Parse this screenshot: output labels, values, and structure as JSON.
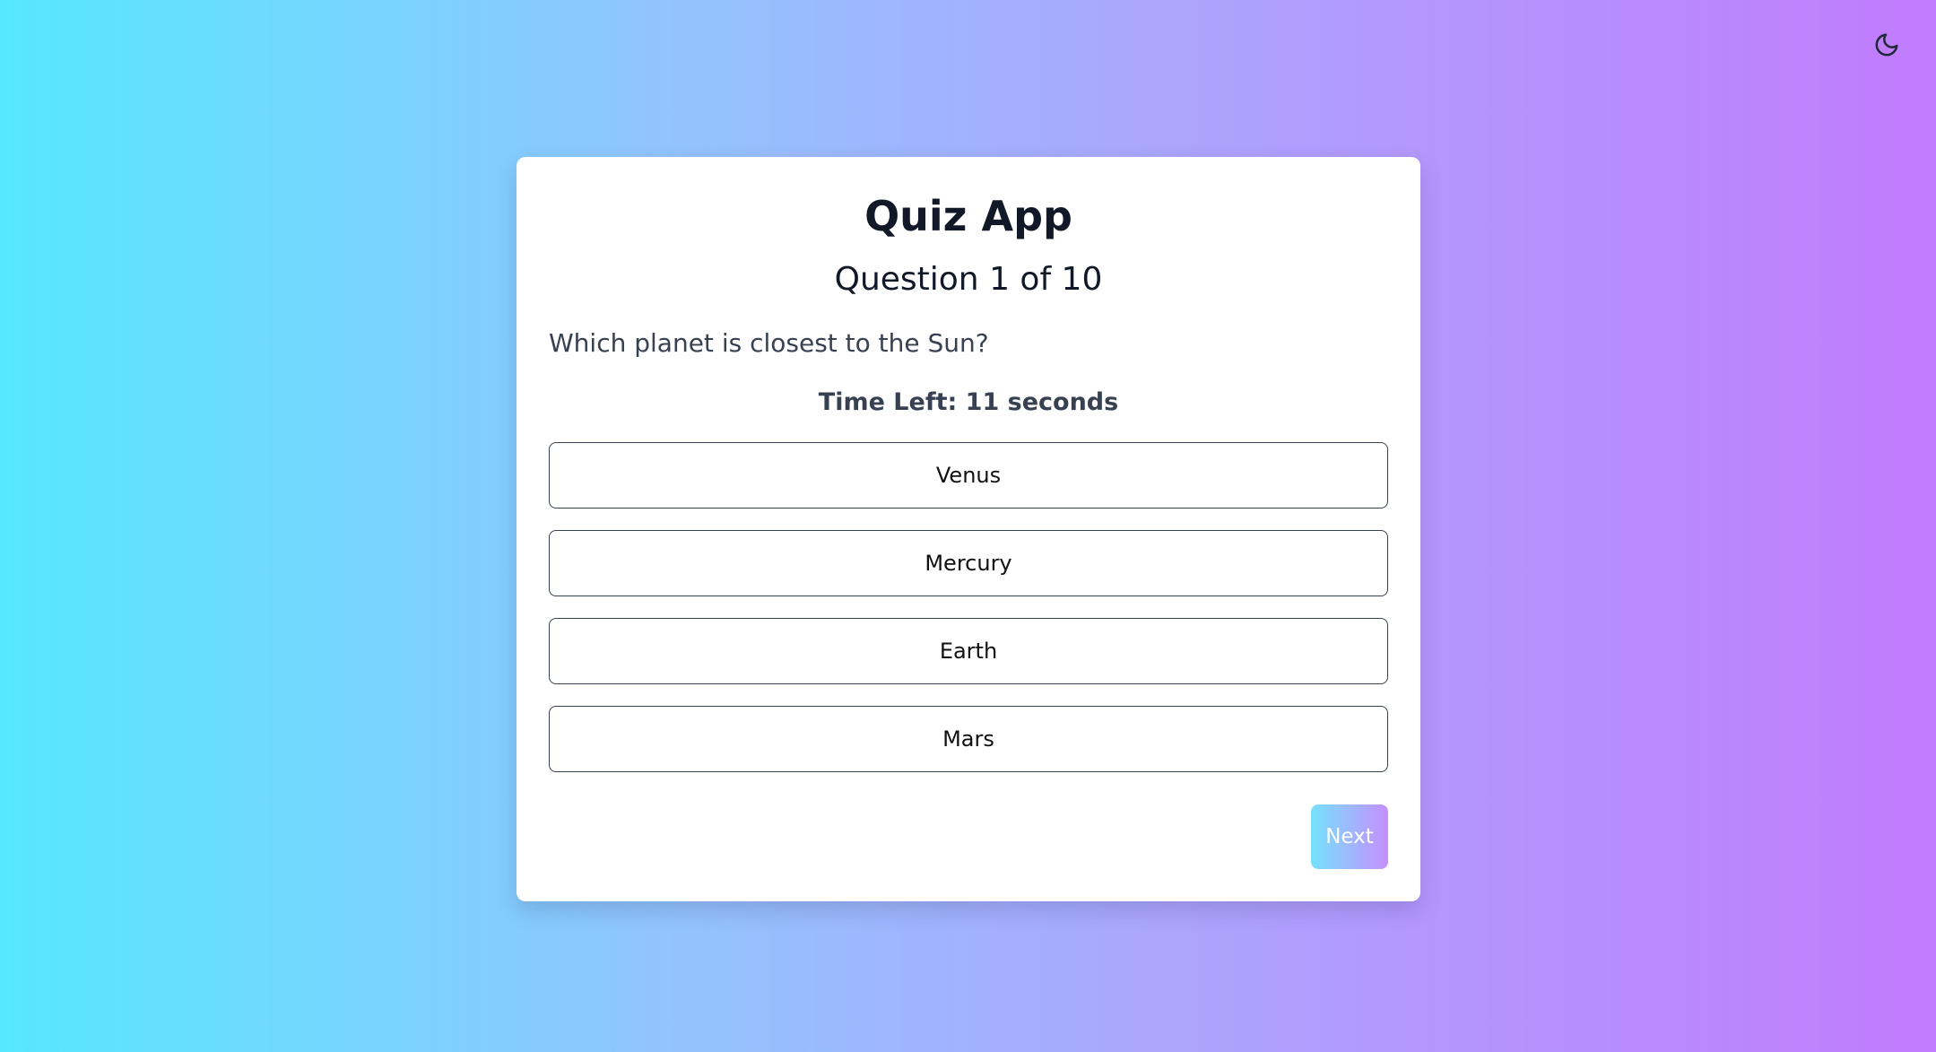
{
  "header": {
    "theme_toggle_icon": "moon-icon"
  },
  "quiz": {
    "title": "Quiz App",
    "progress": "Question 1 of 10",
    "question": "Which planet is closest to the Sun?",
    "timer": "Time Left: 11 seconds",
    "options": [
      {
        "label": "Venus"
      },
      {
        "label": "Mercury"
      },
      {
        "label": "Earth"
      },
      {
        "label": "Mars"
      }
    ],
    "next_label": "Next"
  },
  "colors": {
    "background_start": "#56e8fd",
    "background_end": "#c17bfd",
    "next_gradient_start": "#67dffd",
    "next_gradient_end": "#c084fd",
    "card": "#ffffff",
    "text_dark": "#111827"
  }
}
